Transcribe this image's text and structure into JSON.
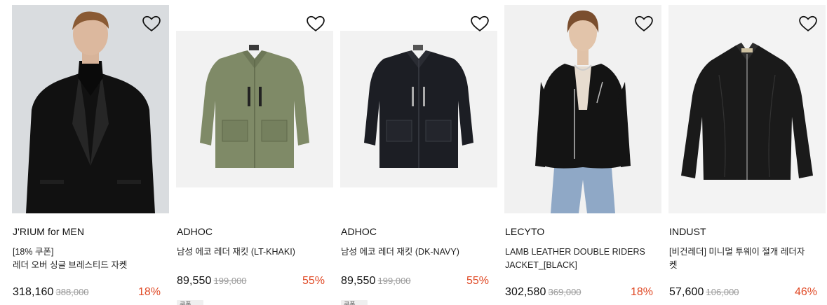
{
  "products": [
    {
      "brand": "J'RIUM for MEN",
      "name_lines": [
        "[18% 쿠폰]",
        "레더 오버 싱글 브레스티드 자켓"
      ],
      "price": "318,160",
      "original_price": "388,000",
      "discount": "18%",
      "badge": "",
      "image_type": "model-wearing-blazer",
      "background": "#d9dcdf"
    },
    {
      "brand": "ADHOC",
      "name_lines": [
        "남성 에코 레더 재킷 (LT-KHAKI)"
      ],
      "price": "89,550",
      "original_price": "199,000",
      "discount": "55%",
      "badge": "쿠폰",
      "image_type": "jacket-flat",
      "background": "#f2f2f2",
      "garment_color": "#7f8a67"
    },
    {
      "brand": "ADHOC",
      "name_lines": [
        "남성 에코 레더 재킷 (DK-NAVY)"
      ],
      "price": "89,550",
      "original_price": "199,000",
      "discount": "55%",
      "badge": "쿠폰",
      "image_type": "jacket-flat",
      "background": "#f2f2f2",
      "garment_color": "#1c1e24"
    },
    {
      "brand": "LECYTO",
      "name_lines": [
        "LAMB LEATHER DOUBLE RIDERS",
        "JACKET_[BLACK]"
      ],
      "price": "302,580",
      "original_price": "369,000",
      "discount": "18%",
      "badge": "",
      "image_type": "model-wearing-riders",
      "background": "#f1f1f1"
    },
    {
      "brand": "INDUST",
      "name_lines": [
        "[비건레더] 미니멀 투웨이 절개 레더자",
        "켓"
      ],
      "price": "57,600",
      "original_price": "106,000",
      "discount": "46%",
      "badge": "",
      "image_type": "zip-jacket-flat",
      "background": "#f3f3f3",
      "garment_color": "#1a1a1a"
    }
  ],
  "icons": {
    "wishlist": "heart-outline-icon"
  },
  "colors": {
    "discount": "#e04a26",
    "strike": "#999999"
  }
}
